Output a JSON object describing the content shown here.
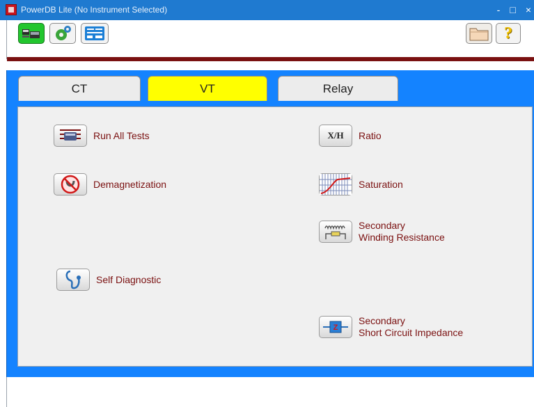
{
  "window": {
    "title": "PowerDB Lite (No Instrument Selected)",
    "controls": {
      "minimize": "-",
      "maximize": "□",
      "close": "×"
    }
  },
  "toolbar": {
    "help_symbol": "?",
    "buttons": [
      {
        "name": "instruments",
        "icon": "instrument-icon"
      },
      {
        "name": "settings",
        "icon": "gear-icon"
      },
      {
        "name": "forms",
        "icon": "form-icon"
      },
      {
        "name": "open",
        "icon": "folder-icon"
      },
      {
        "name": "help",
        "icon": "question-icon"
      }
    ]
  },
  "tabs": [
    {
      "label": "CT",
      "active": false
    },
    {
      "label": "VT",
      "active": true
    },
    {
      "label": "Relay",
      "active": false
    }
  ],
  "tests": {
    "run_all": "Run All Tests",
    "ratio": "Ratio",
    "ratio_icon_text": "X/H",
    "demag": "Demagnetization",
    "saturation": "Saturation",
    "swr_line1": "Secondary",
    "swr_line2": "Winding Resistance",
    "self_diag": "Self Diagnostic",
    "ssci_line1": "Secondary",
    "ssci_line2": "Short Circuit Impedance",
    "ssci_icon_text": "Z"
  },
  "colors": {
    "titlebar": "#1f7ad0",
    "main_blue": "#1483ff",
    "active_tab": "#ffff00",
    "label_text": "#7a1010",
    "accent_bar": "#7a1111",
    "instrument_button": "#22c62e"
  }
}
